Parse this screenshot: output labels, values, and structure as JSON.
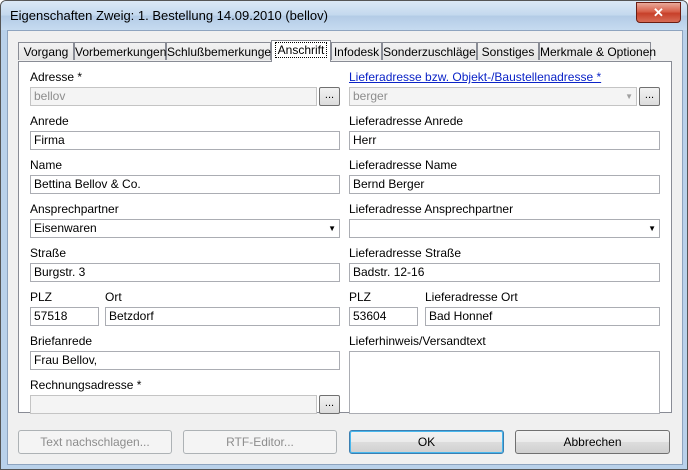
{
  "window": {
    "title": "Eigenschaften Zweig: 1. Bestellung 14.09.2010 (bellov)",
    "close_label": "✕"
  },
  "tabs": [
    "Vorgang",
    "Vorbemerkungen",
    "Schlußbemerkungen",
    "Anschrift",
    "Infodesk",
    "Sonderzuschläge",
    "Sonstiges",
    "Merkmale & Optionen"
  ],
  "active_tab": "Anschrift",
  "left": {
    "adresse": {
      "label": "Adresse *",
      "value": "bellov"
    },
    "anrede": {
      "label": "Anrede",
      "value": "Firma"
    },
    "name": {
      "label": "Name",
      "value": "Bettina Bellov & Co."
    },
    "ansprechpartner": {
      "label": "Ansprechpartner",
      "value": "Eisenwaren"
    },
    "strasse": {
      "label": "Straße",
      "value": "Burgstr. 3"
    },
    "plz": {
      "label": "PLZ",
      "value": "57518"
    },
    "ort": {
      "label": "Ort",
      "value": "Betzdorf"
    },
    "briefanrede": {
      "label": "Briefanrede",
      "value": "Frau Bellov,"
    },
    "rechnungsadresse": {
      "label": "Rechnungsadresse *",
      "value": ""
    }
  },
  "right": {
    "lieferadresse": {
      "label": "Lieferadresse bzw. Objekt-/Baustellenadresse *",
      "value": "berger"
    },
    "anrede": {
      "label": "Lieferadresse Anrede",
      "value": "Herr"
    },
    "name": {
      "label": "Lieferadresse Name",
      "value": "Bernd Berger"
    },
    "ansprechpartner": {
      "label": "Lieferadresse Ansprechpartner",
      "value": ""
    },
    "strasse": {
      "label": "Lieferadresse Straße",
      "value": "Badstr. 12-16"
    },
    "plz": {
      "label": "PLZ",
      "value": "53604"
    },
    "ort": {
      "label": "Lieferadresse Ort",
      "value": "Bad Honnef"
    },
    "hinweis": {
      "label": "Lieferhinweis/Versandtext",
      "value": ""
    }
  },
  "ellipsis": "...",
  "dropdown_arrow": "▼",
  "buttons": {
    "text_nachschlagen": "Text nachschlagen...",
    "rtf_editor": "RTF-Editor...",
    "ok": "OK",
    "abbrechen": "Abbrechen"
  }
}
